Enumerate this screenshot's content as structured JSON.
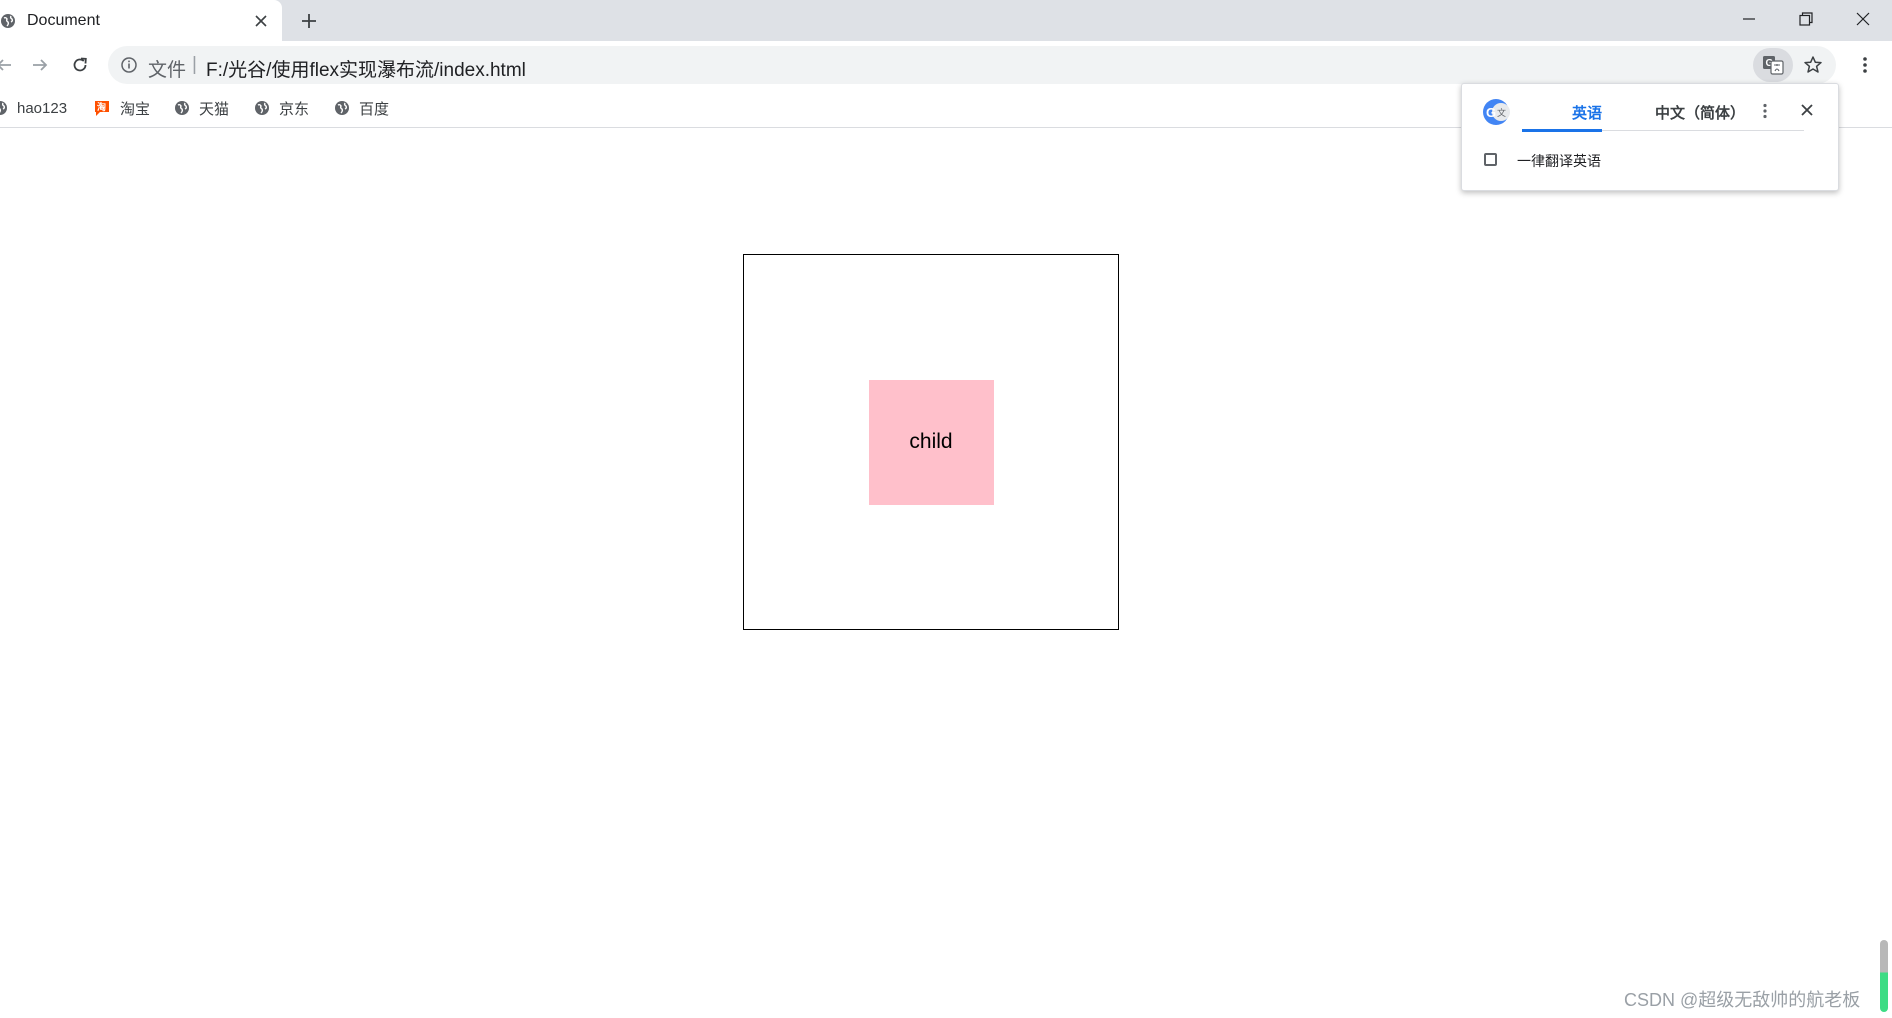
{
  "tab": {
    "title": "Document"
  },
  "address_bar": {
    "scheme_label": "文件",
    "separator": "|",
    "url": "F:/光谷/使用flex实现瀑布流/index.html"
  },
  "bookmarks": [
    {
      "label": "hao123",
      "icon": "globe-icon"
    },
    {
      "label": "淘宝",
      "icon": "taobao-icon"
    },
    {
      "label": "天猫",
      "icon": "globe-icon"
    },
    {
      "label": "京东",
      "icon": "globe-icon"
    },
    {
      "label": "百度",
      "icon": "globe-icon"
    }
  ],
  "page": {
    "child_label": "child"
  },
  "translate_popup": {
    "source_language": "英语",
    "target_language": "中文（简体）",
    "always_translate_label": "一律翻译英语",
    "always_translate_checked": false
  },
  "watermark": "CSDN @超级无敌帅的航老板",
  "colors": {
    "child_background": "#ffc0cb",
    "accent": "#1a73e8",
    "tab_strip": "#dee1e6",
    "omnibox": "#f1f3f4",
    "taobao": "#ff5000"
  }
}
